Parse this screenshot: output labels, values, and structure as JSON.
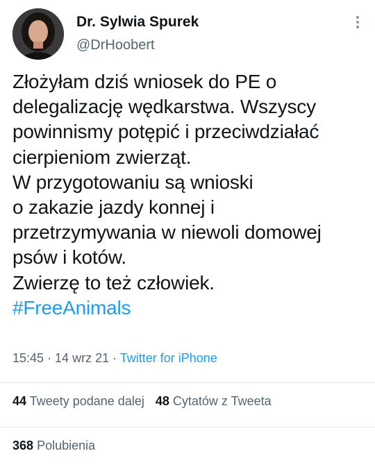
{
  "author": {
    "name": "Dr. Sylwia Spurek",
    "handle": "@DrHoobert"
  },
  "tweet": {
    "lines": [
      "Złożyłam dziś wniosek do PE o",
      "delegalizację wędkarstwa. Wszyscy",
      "powinnismy potępić i przeciwdziałać",
      "cierpieniom zwierząt.",
      "W przygotowaniu są wnioski",
      "o zakazie jazdy konnej i",
      "przetrzymywania w niewoli domowej",
      "psów i kotów.",
      "Zwierzę to też człowiek."
    ],
    "hashtag": "#FreeAnimals"
  },
  "meta": {
    "time": "15:45",
    "separator": " · ",
    "date": "14 wrz 21",
    "source": "Twitter for iPhone"
  },
  "stats": {
    "retweets_count": "44",
    "retweets_label": "Tweety podane dalej",
    "quotes_count": "48",
    "quotes_label": "Cytatów z Tweeta",
    "likes_count": "368",
    "likes_label": "Polubienia"
  },
  "icons": {
    "more": "more-vertical-icon",
    "avatar": "profile-photo"
  },
  "colors": {
    "text": "#0f1419",
    "secondary": "#536471",
    "link": "#1d9bf0",
    "divider": "#e3e7ea"
  }
}
